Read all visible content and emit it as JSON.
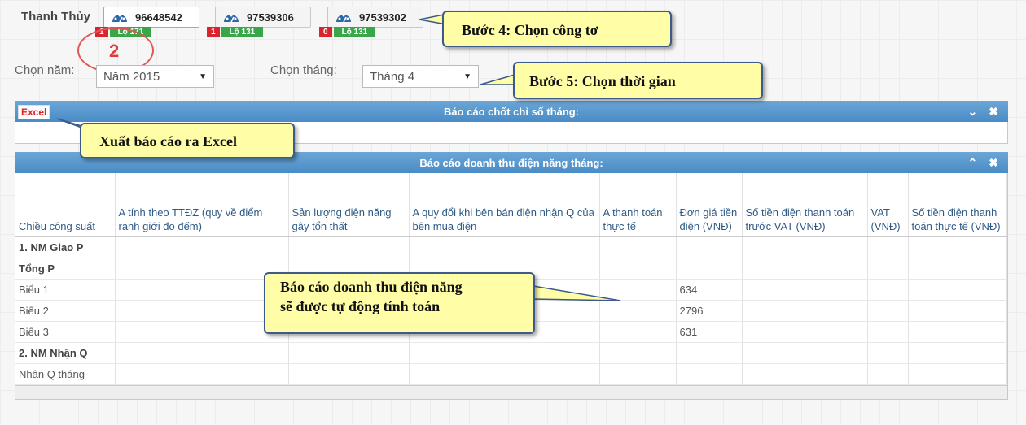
{
  "owner": {
    "name": "Thanh Thủy"
  },
  "meters": [
    {
      "id": "96648542",
      "count": "1",
      "feeder": "Lộ 171",
      "active": true
    },
    {
      "id": "97539306",
      "count": "1",
      "feeder": "Lộ 131",
      "active": false
    },
    {
      "id": "97539302",
      "count": "0",
      "feeder": "Lộ 131",
      "active": false
    }
  ],
  "filters": {
    "year_label": "Chọn năm:",
    "year_value": "Năm 2015",
    "month_label": "Chọn tháng:",
    "month_value": "Tháng 4"
  },
  "panel1": {
    "title": "Báo cáo chốt chỉ số tháng:",
    "excel": "Excel",
    "tool_collapse": "⌄",
    "tool_close": "✖"
  },
  "panel2": {
    "title": "Báo cáo doanh thu điện năng tháng:",
    "tool_expand": "⌃",
    "tool_close": "✖"
  },
  "table": {
    "headers": [
      "Chiều công suất",
      "A tính theo TTĐZ (quy về điểm ranh giới đo đếm)",
      "Sản lượng điện năng gây tổn thất",
      "A quy đổi khi bên bán điện nhận Q của bên mua điện",
      "A thanh toán thực tế",
      "Đơn giá tiền điện (VNĐ)",
      "Số tiền điện thanh toán trước VAT (VNĐ)",
      "VAT (VNĐ)",
      "Số tiền điện thanh toán thực tế (VNĐ)"
    ],
    "rows": [
      {
        "label": "1. NM Giao P",
        "bold": true,
        "price": ""
      },
      {
        "label": "Tổng P",
        "bold": true,
        "price": ""
      },
      {
        "label": "Biểu 1",
        "bold": false,
        "price": "634"
      },
      {
        "label": "Biểu 2",
        "bold": false,
        "price": "2796"
      },
      {
        "label": "Biểu 3",
        "bold": false,
        "price": "631"
      },
      {
        "label": "2. NM Nhận Q",
        "bold": true,
        "price": ""
      },
      {
        "label": "Nhận Q tháng",
        "bold": false,
        "price": ""
      }
    ]
  },
  "annotations": {
    "step_number": "2",
    "step4": "Bước 4: Chọn công tơ",
    "step5": "Bước 5:  Chọn thời gian",
    "excel_note": "Xuất báo cáo ra Excel",
    "auto_note": "Báo cáo doanh thu điện năng sẽ được tự động tính toán"
  },
  "colors": {
    "header_blue": "#4a8cc6",
    "badge_red": "#d9232d",
    "badge_green": "#3aa64a",
    "callout_yellow": "#fffda6"
  }
}
